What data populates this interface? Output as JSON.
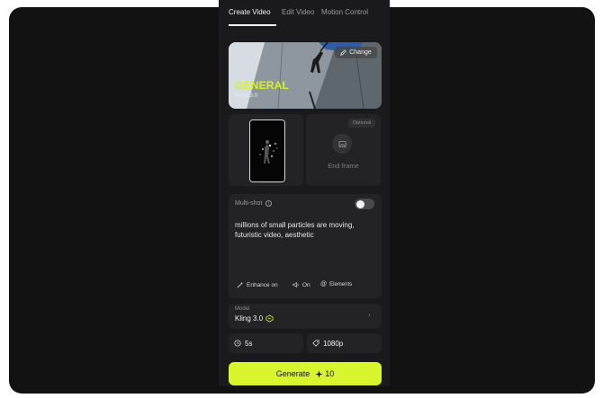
{
  "tabs": [
    {
      "label": "Create Video",
      "active": true
    },
    {
      "label": "Edit Video",
      "active": false
    },
    {
      "label": "Motion Control",
      "active": false
    }
  ],
  "hero": {
    "change_label": "Change",
    "title": "GENERAL",
    "subtitle": "Kling 3.0"
  },
  "frames": {
    "optional_badge": "Optional",
    "end_frame_label": "End frame"
  },
  "prompt": {
    "multishot_label": "Multi-shot",
    "multishot_enabled": false,
    "text": "millions of small particles are moving, futuristic video, aesthetic",
    "chips": {
      "enhance": "Enhance on",
      "audio": "On",
      "elements": "Elements"
    }
  },
  "model": {
    "label": "Model",
    "value": "Kling 3.0"
  },
  "options": {
    "duration": "5s",
    "resolution": "1080p"
  },
  "generate": {
    "label": "Generate",
    "cost": "10"
  },
  "colors": {
    "accent": "#d8f52e",
    "hero_title": "#d4f224",
    "background": "#121212",
    "card": "#232325"
  },
  "icons": [
    "pencil-icon",
    "image-icon",
    "info-icon",
    "sparkle-wand-icon",
    "speaker-icon",
    "at-icon",
    "model-badge-icon",
    "chevron-right-icon",
    "clock-icon",
    "tag-icon",
    "sparkle-icon"
  ]
}
